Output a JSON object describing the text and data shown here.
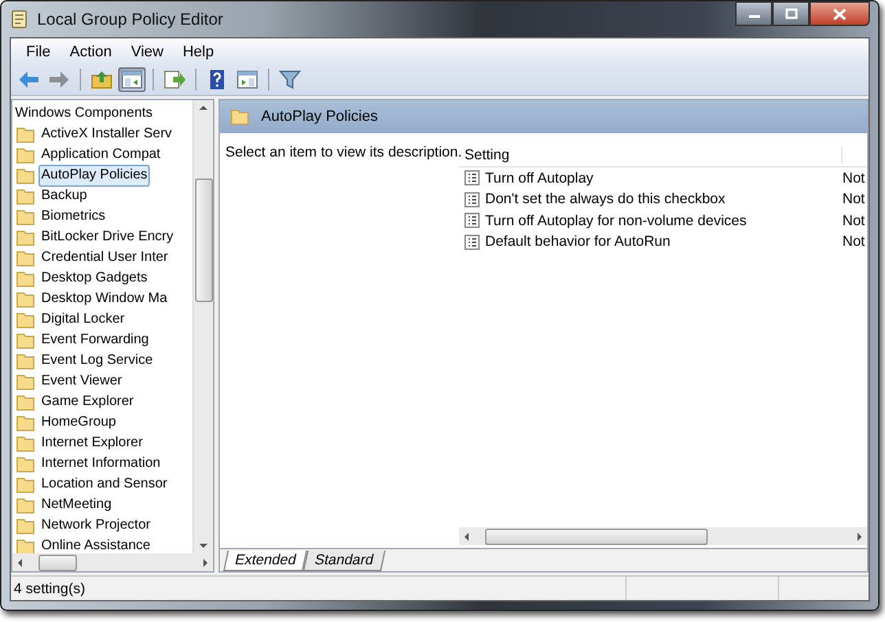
{
  "window": {
    "title": "Local Group Policy Editor"
  },
  "menu": [
    "File",
    "Action",
    "View",
    "Help"
  ],
  "toolbar": [
    {
      "kind": "back",
      "pressed": false
    },
    {
      "kind": "forward",
      "pressed": false
    },
    {
      "kind": "sep"
    },
    {
      "kind": "up",
      "pressed": false
    },
    {
      "kind": "tree",
      "pressed": true
    },
    {
      "kind": "sep"
    },
    {
      "kind": "export",
      "pressed": false
    },
    {
      "kind": "sep"
    },
    {
      "kind": "help",
      "pressed": false
    },
    {
      "kind": "pane",
      "pressed": false
    },
    {
      "kind": "sep"
    },
    {
      "kind": "filter",
      "pressed": false
    }
  ],
  "tree": {
    "label": "Windows Components",
    "children": [
      {
        "label": "ActiveX Installer Serv",
        "selected": false
      },
      {
        "label": "Application Compat",
        "selected": false
      },
      {
        "label": "AutoPlay Policies",
        "selected": true
      },
      {
        "label": "Backup",
        "selected": false
      },
      {
        "label": "Biometrics",
        "selected": false
      },
      {
        "label": "BitLocker Drive Encry",
        "selected": false
      },
      {
        "label": "Credential User Inter",
        "selected": false
      },
      {
        "label": "Desktop Gadgets",
        "selected": false
      },
      {
        "label": "Desktop Window Ma",
        "selected": false
      },
      {
        "label": "Digital Locker",
        "selected": false
      },
      {
        "label": "Event Forwarding",
        "selected": false
      },
      {
        "label": "Event Log Service",
        "selected": false
      },
      {
        "label": "Event Viewer",
        "selected": false
      },
      {
        "label": "Game Explorer",
        "selected": false
      },
      {
        "label": "HomeGroup",
        "selected": false
      },
      {
        "label": "Internet Explorer",
        "selected": false
      },
      {
        "label": "Internet Information",
        "selected": false
      },
      {
        "label": "Location and Sensor",
        "selected": false
      },
      {
        "label": "NetMeeting",
        "selected": false
      },
      {
        "label": "Network Projector",
        "selected": false
      },
      {
        "label": "Online Assistance",
        "selected": false
      }
    ]
  },
  "content": {
    "header": "AutoPlay Policies",
    "description": "Select an item to view its description.",
    "table": {
      "columns": [
        "Setting"
      ],
      "rows": [
        {
          "setting": "Turn off Autoplay",
          "column_2": "Not"
        },
        {
          "setting": "Don't set the always do this checkbox",
          "column_2": "Not"
        },
        {
          "setting": "Turn off Autoplay for non-volume devices",
          "column_2": "Not"
        },
        {
          "setting": "Default behavior for AutoRun",
          "column_2": "Not"
        }
      ]
    }
  },
  "tabs": [
    {
      "label": "Extended",
      "selected": true
    },
    {
      "label": "Standard",
      "selected": false
    }
  ],
  "status_bar": "4 setting(s)"
}
